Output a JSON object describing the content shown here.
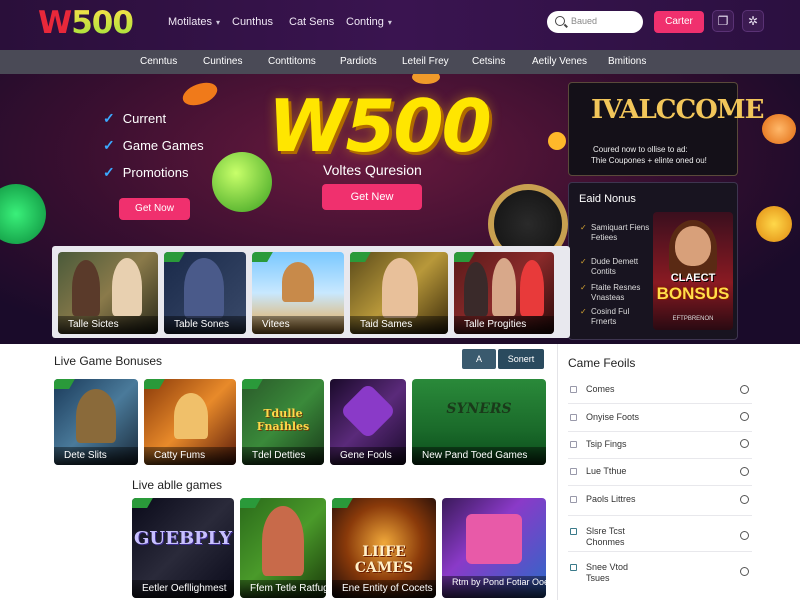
{
  "brand": {
    "logo_w": "W",
    "logo_num": "500"
  },
  "header": {
    "nav": [
      {
        "label": "Motilates",
        "dropdown": true
      },
      {
        "label": "Cunthus",
        "dropdown": false
      },
      {
        "label": "Cat Sens",
        "dropdown": false
      },
      {
        "label": "Conting",
        "dropdown": true
      }
    ],
    "search_placeholder": "Baued",
    "cta_label": "Carter",
    "icons": [
      "clipboard-icon",
      "settings-icon"
    ]
  },
  "subnav": [
    "Cenntus",
    "Cuntines",
    "Conttitoms",
    "Pardiots",
    "Leteil Frey",
    "Cetsins",
    "Aetily Venes",
    "Bmitions"
  ],
  "hero": {
    "checklist": [
      "Current",
      "Game Games",
      "Promotions"
    ],
    "cta_left": "Get Now",
    "title": "W500",
    "subtitle": "Voltes Quresion",
    "cta_center": "Get New"
  },
  "welcome": {
    "title": "IVALCCOME",
    "line1": "Coured now to ollise to ad:",
    "line2": "Thie Coupones + elinte oned ou!"
  },
  "bonus_panel": {
    "heading": "Eaid Nonus",
    "items": [
      "Samiquart Fiens Fetiees",
      "Dude Demett Contits",
      "Ftaite Resnes Vnasteas",
      "Cosind Ful Frnerts"
    ],
    "card": {
      "line1": "CLAECT",
      "line2": "BONSUS",
      "line3": "EFTPBRENON"
    }
  },
  "hero_tiles": [
    "Talle Sictes",
    "Table Sones",
    "Vitees",
    "Taid Sames",
    "Talle Progities"
  ],
  "live_bonuses": {
    "heading": "Live Game Bonuses",
    "toggle_a": "A",
    "toggle_b": "Sonert",
    "tiles": [
      "Dete Slits",
      "Catty Fums",
      "Tdel Detties",
      "Gene Fools",
      "New Pand Toed Games"
    ],
    "tile_captions": [
      "",
      "",
      "Tdulle Fnaihles",
      "",
      "SYNERS"
    ]
  },
  "live_table": {
    "heading": "Live ablle games",
    "tiles": [
      "Eetler Oefllighmest",
      "Ffem Tetle Ratfuges",
      "Ene Entity of Cocets",
      "Rtm by Pond Fotiar Ooes"
    ],
    "tile_captions": [
      "GUEBPLY",
      "",
      "LIIFE CAMES",
      ""
    ]
  },
  "game_feeds": {
    "heading": "Came Feoils",
    "rows": [
      "Comes",
      "Onyise Foots",
      "Tsip Fings",
      "Lue Tthue",
      "Paols Littres",
      "Slsre Tcst Chonmes",
      "Snee Vtod Tsues"
    ]
  },
  "colors": {
    "accent_pink": "#f0306e",
    "brand_yellow": "#ffe600",
    "header_purple": "#3a1450",
    "subnav_gray": "#4a4a56"
  }
}
